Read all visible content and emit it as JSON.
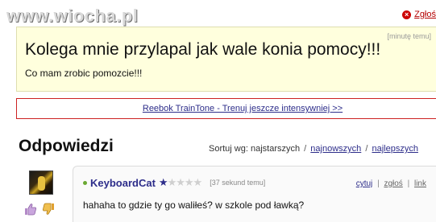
{
  "watermark": "www.wiocha.pl",
  "report": {
    "label": "Zgłoś"
  },
  "question": {
    "meta": "[minutę temu]",
    "title": "Kolega mnie przylapal jak wale konia pomocy!!!",
    "body": "Co mam zrobic pomozcie!!!"
  },
  "ad": {
    "text": "Reebok TrainTone - Trenuj jeszcze intensywniej >>"
  },
  "answers": {
    "title": "Odpowiedzi",
    "sort": {
      "label": "Sortuj wg: najstarszych",
      "sep": "/",
      "option_newest": "najnowszych",
      "option_best": "najlepszych"
    }
  },
  "answer": {
    "author": "KeyboardCat",
    "rating": {
      "value": 1,
      "max": 5
    },
    "time": "[37 sekund temu]",
    "actions": {
      "cite": "cytuj",
      "report": "zgłoś",
      "link": "link",
      "sep": "|"
    },
    "text": "hahaha to gdzie ty go waliłeś? w szkole pod ławką?"
  },
  "colors": {
    "link": "#2d2d8a",
    "question_bg": "#ffffdd",
    "ad_border": "#cc2222",
    "report": "#b40000"
  }
}
